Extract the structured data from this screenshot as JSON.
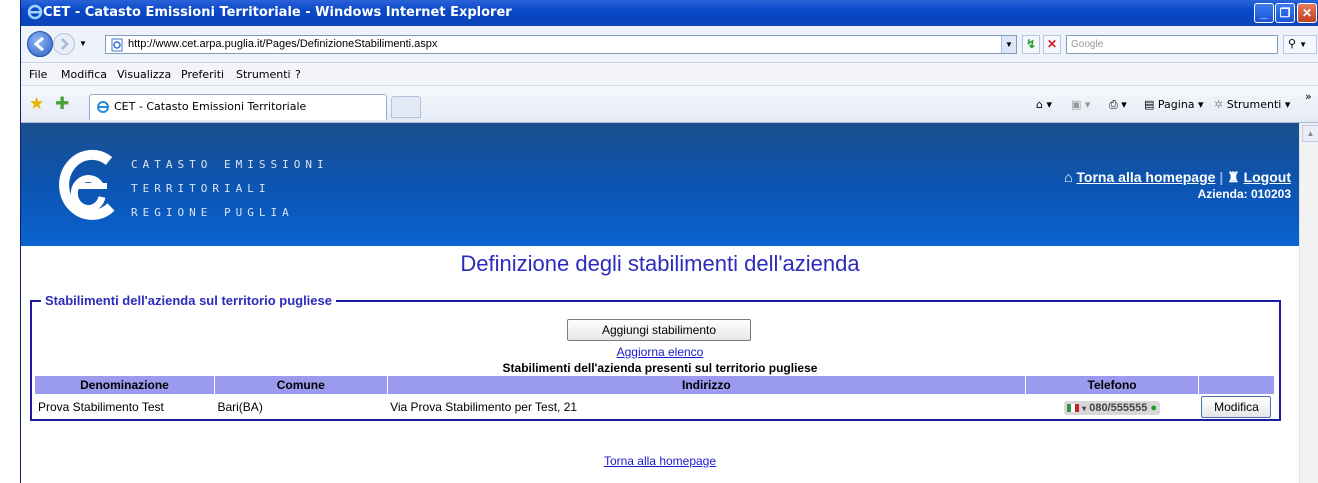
{
  "window": {
    "title": "CET - Catasto Emissioni Territoriale - Windows Internet Explorer"
  },
  "toolbar": {
    "url": "http://www.cet.arpa.puglia.it/Pages/DefinizioneStabilimenti.aspx",
    "search_placeholder": "Google"
  },
  "menu": {
    "items": [
      "File",
      "Modifica",
      "Visualizza",
      "Preferiti",
      "Strumenti",
      "?"
    ]
  },
  "tabs": {
    "active_label": "CET - Catasto Emissioni Territoriale",
    "page_label": "Pagina",
    "tools_label": "Strumenti"
  },
  "banner": {
    "line1": "CATASTO EMISSIONI",
    "line2": "TERRITORIALI",
    "line3": "REGIONE PUGLIA",
    "home_link": "Torna alla homepage",
    "logout_link": "Logout",
    "separator": "|",
    "azienda": "Azienda: 010203"
  },
  "main": {
    "title": "Definizione degli stabilimenti dell'azienda",
    "fieldset_legend": "Stabilimenti dell'azienda sul territorio pugliese",
    "add_button": "Aggiungi stabilimento",
    "refresh_link": "Aggiorna elenco",
    "table_caption": "Stabilimenti dell'azienda presenti sul territorio pugliese",
    "columns": [
      "Denominazione",
      "Comune",
      "Indirizzo",
      "Telefono"
    ],
    "rows": [
      {
        "denominazione": "Prova Stabilimento Test",
        "comune": "Bari(BA)",
        "indirizzo": "Via Prova Stabilimento per Test, 21",
        "telefono": "080/555555",
        "action": "Modifica"
      }
    ],
    "footer_link": "Torna alla homepage"
  },
  "colors": {
    "banner": "#0b55b4",
    "title": "#2c2cbc",
    "table_header": "#9a9aee",
    "fieldset_border": "#1a1aa0"
  }
}
